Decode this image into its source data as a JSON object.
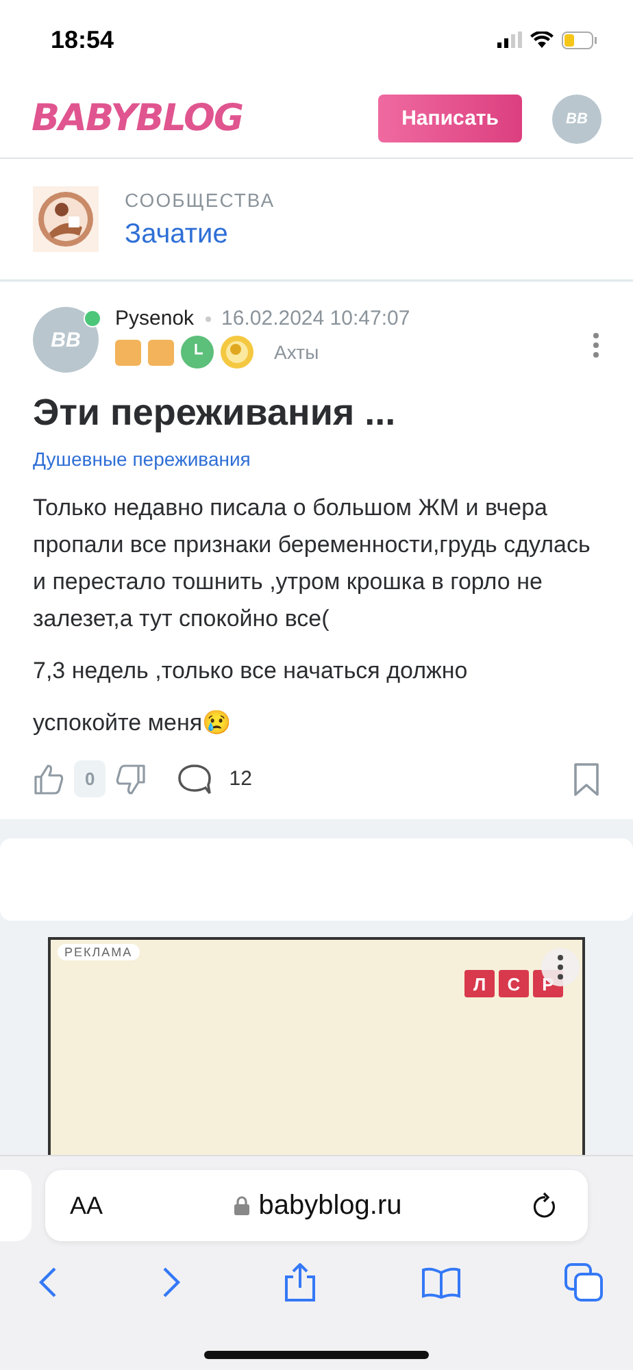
{
  "status_bar": {
    "time": "18:54"
  },
  "header": {
    "logo": "BABYBLOG",
    "write_button": "Написать",
    "avatar": "BB"
  },
  "community": {
    "section": "СООБЩЕСТВА",
    "name": "Зачатие"
  },
  "post": {
    "author": "Pysenok",
    "online": true,
    "date": "16.02.2024 10:47:07",
    "avatar": "BB",
    "city": "Ахты",
    "badges": [
      {
        "kind": "square",
        "color": "#f2b35a"
      },
      {
        "kind": "square",
        "color": "#f2b35a"
      },
      {
        "kind": "clock",
        "color": "#5cbf7a"
      },
      {
        "kind": "coin",
        "color": "#f5c842"
      }
    ],
    "title": "Эти переживания ...",
    "category": "Душевные переживания",
    "paragraphs": [
      "Только недавно писала о большом ЖМ и вчера пропали все признаки беременности,грудь сдулась и перестало тошнить ,утром крошка в горло не залезет,а тут спокойно все(",
      "7,3 недель ,только все начаться должно",
      "успокойте меня😢"
    ],
    "votes": "0",
    "comments": "12"
  },
  "ad": {
    "label": "РЕКЛАМА",
    "logo_letters": [
      "Л",
      "С",
      "Р"
    ]
  },
  "browser": {
    "text_size": "AA",
    "url": "babyblog.ru"
  }
}
